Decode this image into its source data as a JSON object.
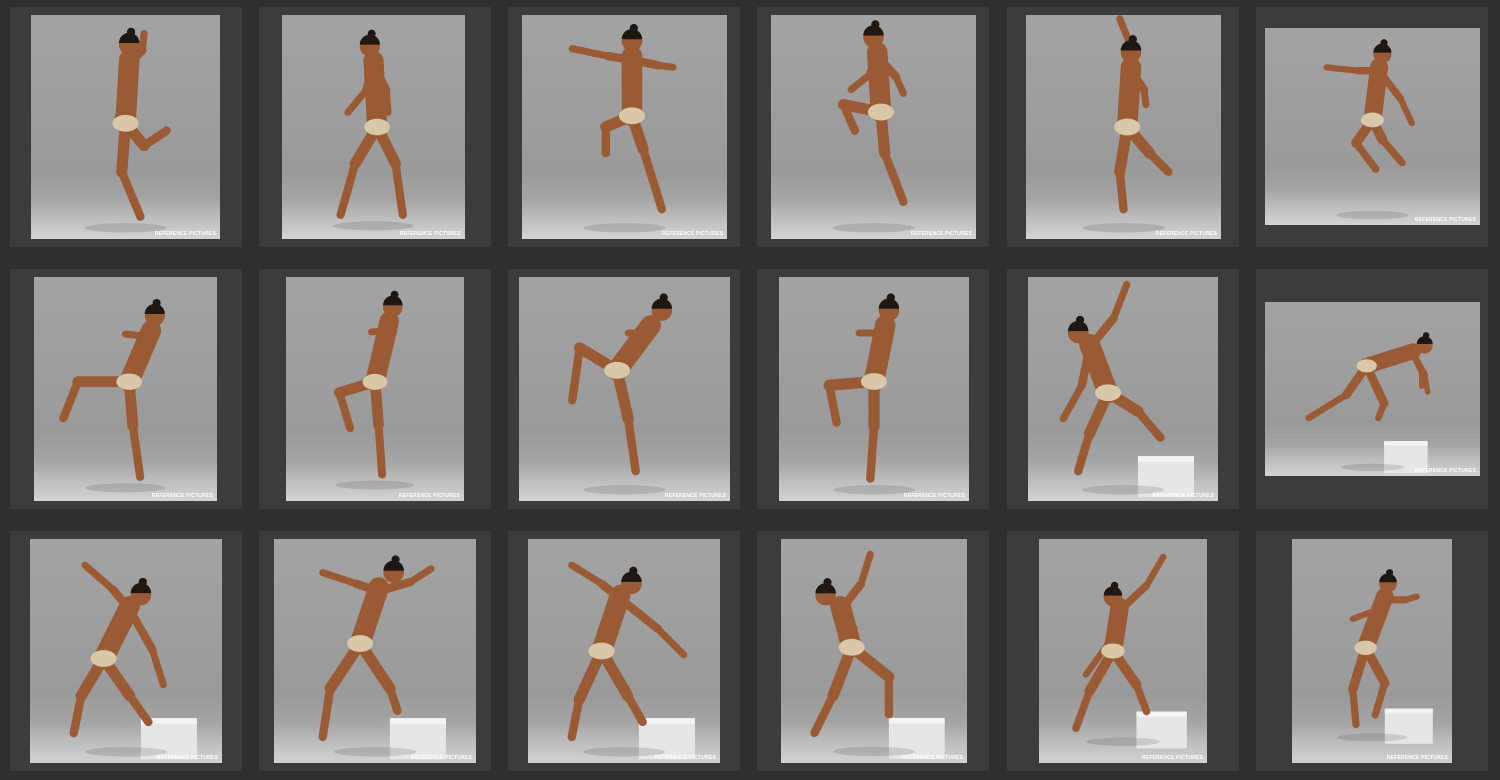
{
  "gallery": {
    "watermark_text": "REFERENCE PICTURES",
    "colors": {
      "page_background": "#2f2f2f",
      "tile_background": "#3c3c3c",
      "photo_background": "#a0a0a0",
      "skin": "#9a5a34",
      "underwear": "#d9c7a8",
      "hair": "#1e1712",
      "block": "#e6e6e6"
    },
    "tiles": [
      {
        "pose": "jump-side-knee-up",
        "has_block": false
      },
      {
        "pose": "crouch-fists",
        "has_block": false
      },
      {
        "pose": "jump-tuck-arms-out",
        "has_block": false
      },
      {
        "pose": "jump-tuck-knee-chest",
        "has_block": false
      },
      {
        "pose": "jump-arm-reach-up",
        "has_block": false
      },
      {
        "pose": "jump-arms-flex",
        "has_block": false
      },
      {
        "pose": "knee-raise-guard",
        "has_block": false
      },
      {
        "pose": "knee-raise-guard-front",
        "has_block": false
      },
      {
        "pose": "high-knee-lean-back",
        "has_block": false
      },
      {
        "pose": "knee-raise-guard-turn",
        "has_block": false
      },
      {
        "pose": "reach-up-step-block",
        "has_block": true
      },
      {
        "pose": "lunge-push-block",
        "has_block": true
      },
      {
        "pose": "back-flex-step-block",
        "has_block": true
      },
      {
        "pose": "back-double-flex-block",
        "has_block": true
      },
      {
        "pose": "back-flex-turn-block",
        "has_block": true
      },
      {
        "pose": "arm-up-hand-hip-block",
        "has_block": true
      },
      {
        "pose": "reach-up-diagonal-block",
        "has_block": true
      },
      {
        "pose": "profile-step-block",
        "has_block": true
      }
    ]
  }
}
